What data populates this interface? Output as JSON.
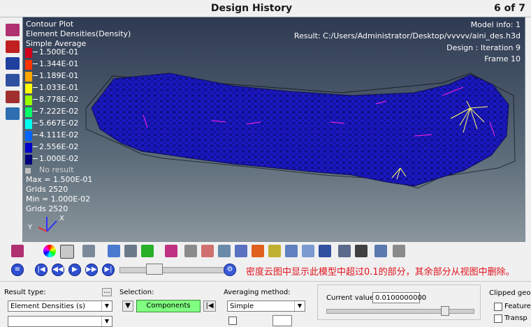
{
  "window": {
    "title": "Design History",
    "page_indicator": "6 of 7"
  },
  "viewport": {
    "plot_type": "Contour Plot",
    "result_name": "Element Densities(Density)",
    "averaging": "Simple Average",
    "model_info": "Model info: 1",
    "result_file": "Result:  C:/Users/Administrator/Desktop/vvvvv/aini_des.h3d",
    "design_iteration": "Design : Iteration 9",
    "frame": "Frame 10",
    "legend": [
      {
        "label": "1.500E-01",
        "color": "#d0001a"
      },
      {
        "label": "1.344E-01",
        "color": "#ff3300"
      },
      {
        "label": "1.189E-01",
        "color": "#ffa500"
      },
      {
        "label": "1.033E-01",
        "color": "#ffff00"
      },
      {
        "label": "8.778E-02",
        "color": "#99ff00"
      },
      {
        "label": "7.222E-02",
        "color": "#00ff66"
      },
      {
        "label": "5.667E-02",
        "color": "#00ffee"
      },
      {
        "label": "4.111E-02",
        "color": "#0066ff"
      },
      {
        "label": "2.556E-02",
        "color": "#0000cc"
      },
      {
        "label": "1.000E-02",
        "color": "#00007a"
      }
    ],
    "no_result": "No result",
    "stats": [
      "Max = 1.500E-01",
      "Grids 2520",
      "Min = 1.000E-02",
      "Grids 2520"
    ],
    "axis_y": "Y",
    "axis_x": "X",
    "colors": {
      "mesh": "#1a1ad8",
      "hot": "#ffff66",
      "outline": "#e020e0"
    }
  },
  "lefttools": [
    {
      "icon": "contour-plot-icon",
      "color": "#b03070"
    },
    {
      "icon": "deformed-plot-icon",
      "color": "#c02020"
    },
    {
      "icon": "vector-plot-icon",
      "color": "#2040a0"
    },
    {
      "icon": "tensor-plot-icon",
      "color": "#3050a0"
    },
    {
      "icon": "measure-icon",
      "color": "#a03030"
    },
    {
      "icon": "screen-display-icon",
      "color": "#2d6fb0"
    }
  ],
  "toolbar1_icons": [
    "contour-toolbar-icon",
    "color-wheel-icon",
    "mesh-cube-icon",
    "solid-cube-icon",
    "mirror-icon",
    "split-cube-icon",
    "legend-icon",
    "curve-icon",
    "wire-icon",
    "section-icon",
    "probe-icon",
    "iso-icon",
    "ruler-icon",
    "note-icon",
    "tracking-icon",
    "frame-icon",
    "measure-tool-icon",
    "annotate-icon",
    "cut-icon",
    "box-icon",
    "light-icon"
  ],
  "animation": {
    "note": "密度云图中显示此模型中超过0.1的部分，其余部分从视图中删除。",
    "slider_fraction": 0.3
  },
  "panel": {
    "result_type_label": "Result type:",
    "result_type_value": "Element Densities (s)",
    "selection_label": "Selection:",
    "selection_value": "Components",
    "averaging_label": "Averaging method:",
    "averaging_value": "Simple",
    "current_value_label": "Current value:",
    "current_value": "0.0100000000",
    "current_slider_fraction": 0.82,
    "clipped_label": "Clipped geom",
    "feature_label": "Feature",
    "transparent_label": "Transp"
  }
}
